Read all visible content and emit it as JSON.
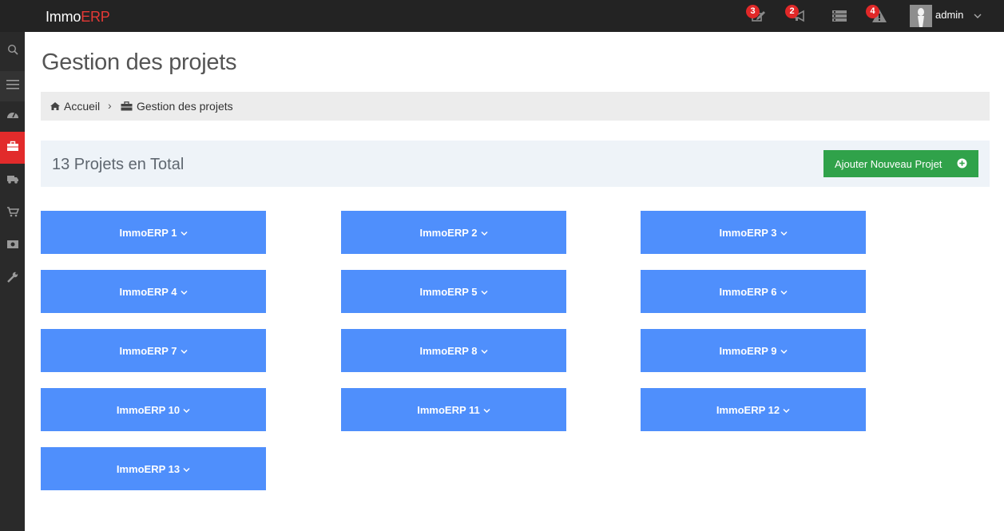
{
  "topbar": {
    "brand_main": "Immo",
    "brand_accent": "ERP",
    "notifications": [
      {
        "icon": "edit-icon",
        "count": "3"
      },
      {
        "icon": "megaphone-icon",
        "count": "2"
      },
      {
        "icon": "server-icon",
        "count": ""
      },
      {
        "icon": "warning-icon",
        "count": "4"
      }
    ],
    "username": "admin"
  },
  "sidebar": {
    "items": [
      {
        "icon": "search-icon",
        "active": false
      },
      {
        "icon": "menu-icon",
        "active": false
      },
      {
        "icon": "dashboard-icon",
        "active": false
      },
      {
        "icon": "briefcase-icon",
        "active": true
      },
      {
        "icon": "truck-icon",
        "active": false
      },
      {
        "icon": "cart-icon",
        "active": false
      },
      {
        "icon": "money-icon",
        "active": false
      },
      {
        "icon": "wrench-icon",
        "active": false
      }
    ]
  },
  "page": {
    "title": "Gestion des projets",
    "breadcrumb": {
      "home": "Accueil",
      "current": "Gestion des projets"
    },
    "summary": "13 Projets en Total",
    "add_button": "Ajouter Nouveau Projet"
  },
  "projects": [
    "ImmoERP 1",
    "ImmoERP 2",
    "ImmoERP 3",
    "ImmoERP 4",
    "ImmoERP 5",
    "ImmoERP 6",
    "ImmoERP 7",
    "ImmoERP 8",
    "ImmoERP 9",
    "ImmoERP 10",
    "ImmoERP 11",
    "ImmoERP 12",
    "ImmoERP 13"
  ],
  "colors": {
    "topbar": "#232323",
    "brand_accent": "#e53935",
    "sidebar": "#2a2a2a",
    "sidebar_active": "#e22b2b",
    "badge": "#e02828",
    "project_button": "#4f8ffc",
    "add_button": "#30a24a"
  }
}
